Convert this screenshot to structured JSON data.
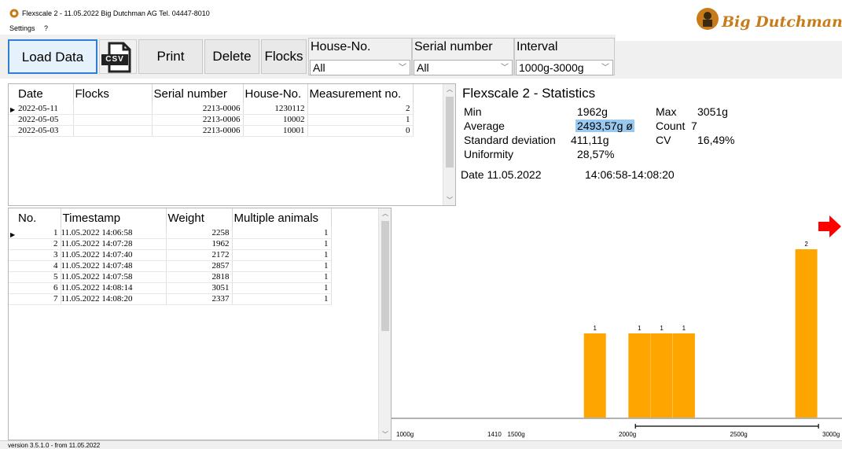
{
  "window": {
    "title": "Flexscale 2 - 11.05.2022 Big Dutchman AG  Tel. 04447-8010",
    "minimize": "–",
    "maximize": "☐",
    "close": "✕"
  },
  "menu": {
    "settings": "Settings",
    "help": "?"
  },
  "toolbar": {
    "load_data": "Load Data",
    "csv": "CSV",
    "print": "Print",
    "delete": "Delete",
    "flocks": "Flocks",
    "house_label": "House-No.",
    "house_value": "All",
    "serial_label": "Serial number",
    "serial_value": "All",
    "interval_label": "Interval",
    "interval_value": "1000g-3000g"
  },
  "logo": {
    "text": "Big Dutchman."
  },
  "flocks_table": {
    "headers": [
      "Date",
      "Flocks",
      "Serial number",
      "House-No.",
      "Measurement no."
    ],
    "rows": [
      [
        "2022-05-11",
        "",
        "2213-0006",
        "1230112",
        "2"
      ],
      [
        "2022-05-05",
        "",
        "2213-0006",
        "10002",
        "1"
      ],
      [
        "2022-05-03",
        "",
        "2213-0006",
        "10001",
        "0"
      ]
    ]
  },
  "stats": {
    "title": "Flexscale 2 - Statistics",
    "min_label": "Min",
    "min_value": "1962g",
    "max_label": "Max",
    "max_value": "3051g",
    "avg_label": "Average",
    "avg_value": "2493,57g ø",
    "count_label": "Count",
    "count_value": "7",
    "sd_label": "Standard deviation",
    "sd_value": "411,11g",
    "cv_label": "CV",
    "cv_value": "16,49%",
    "uni_label": "Uniformity",
    "uni_value": "28,57%",
    "date_label": "Date 11.05.2022",
    "time_range": "14:06:58-14:08:20"
  },
  "meas_table": {
    "headers": [
      "No.",
      "Timestamp",
      "Weight",
      "Multiple animals"
    ],
    "rows": [
      [
        "1",
        "11.05.2022 14:06:58",
        "2258",
        "1"
      ],
      [
        "2",
        "11.05.2022 14:07:28",
        "1962",
        "1"
      ],
      [
        "3",
        "11.05.2022 14:07:40",
        "2172",
        "1"
      ],
      [
        "4",
        "11.05.2022 14:07:48",
        "2857",
        "1"
      ],
      [
        "5",
        "11.05.2022 14:07:58",
        "2818",
        "1"
      ],
      [
        "6",
        "11.05.2022 14:08:14",
        "3051",
        "1"
      ],
      [
        "7",
        "11.05.2022 14:08:20",
        "2337",
        "1"
      ]
    ]
  },
  "chart_data": {
    "type": "bar",
    "xlim": [
      1000,
      3000
    ],
    "ticks": [
      {
        "value": 1000,
        "label": "1000g"
      },
      {
        "value": 1410,
        "label": "1410"
      },
      {
        "value": 1500,
        "label": "1500g"
      },
      {
        "value": 2000,
        "label": "2000g"
      },
      {
        "value": 2500,
        "label": "2500g"
      },
      {
        "value": 3000,
        "label": "3000g"
      }
    ],
    "bars": [
      {
        "x": 1900,
        "count": 1
      },
      {
        "x": 2100,
        "count": 1
      },
      {
        "x": 2200,
        "count": 1
      },
      {
        "x": 2300,
        "count": 1
      },
      {
        "x": 2850,
        "count": 2
      }
    ],
    "range_marker": [
      2082,
      2905
    ],
    "bar_color": "#ffa500",
    "arrow_color": "#ff0000"
  },
  "status": {
    "version": "version 3.5.1.0 - from 11.05.2022"
  }
}
